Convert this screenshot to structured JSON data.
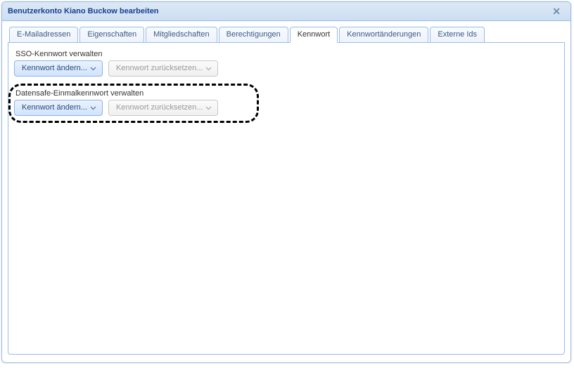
{
  "window": {
    "title": "Benutzerkonto Kiano Buckow bearbeiten",
    "close_glyph": "✕"
  },
  "tabs": [
    {
      "label": "E-Mailadressen"
    },
    {
      "label": "Eigenschaften"
    },
    {
      "label": "Mitgliedschaften"
    },
    {
      "label": "Berechtigungen"
    },
    {
      "label": "Kennwort"
    },
    {
      "label": "Kennwortänderungen"
    },
    {
      "label": "Externe Ids"
    }
  ],
  "active_tab_index": 4,
  "sections": {
    "sso": {
      "label": "SSO-Kennwort verwalten",
      "change_label": "Kennwort ändern...",
      "reset_label": "Kennwort zurücksetzen..."
    },
    "datensafe": {
      "label": "Datensafe-Einmalkennwort verwalten",
      "change_label": "Kennwort ändern...",
      "reset_label": "Kennwort zurücksetzen..."
    }
  }
}
